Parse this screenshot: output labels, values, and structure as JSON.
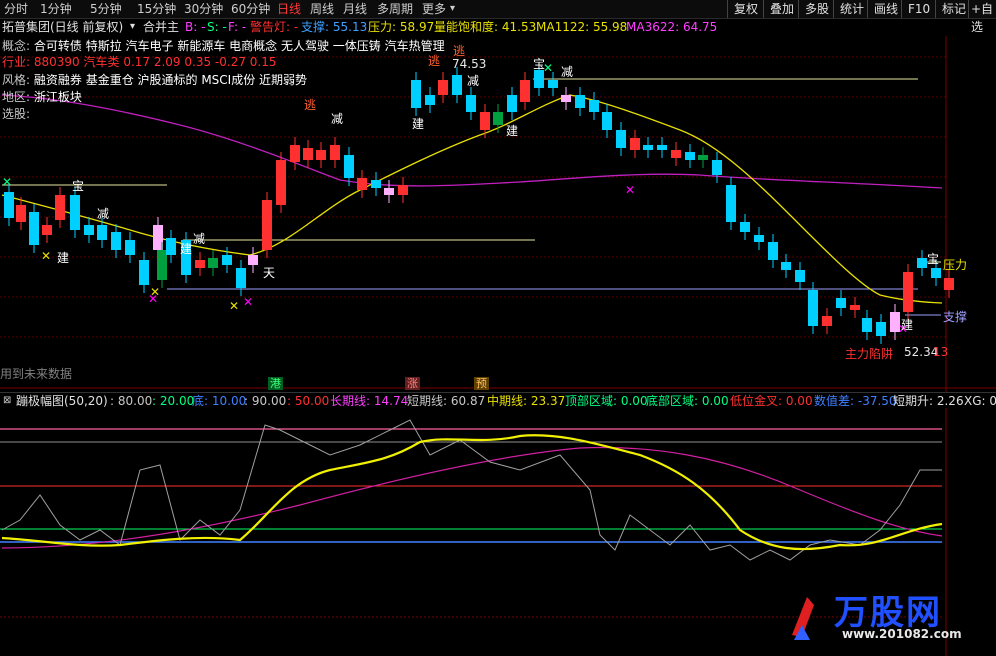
{
  "toolbar": {
    "tabs": [
      "分时",
      "1分钟",
      "5分钟",
      "15分钟",
      "30分钟",
      "60分钟",
      "日线",
      "周线",
      "月线",
      "多周期",
      "更多"
    ],
    "more_arrow": "▾",
    "right_buttons": [
      "复权",
      "叠加",
      "多股",
      "统计",
      "画线",
      "F10",
      "标记",
      "+自选"
    ],
    "active_tab": "日线"
  },
  "header": {
    "stock_name": "拓普集团(日线 前复权)",
    "dropdown_icon": "▾",
    "indicator_name": "合并主",
    "b_label": "B: -",
    "s_label": "S: -",
    "f_label": "F: -",
    "alarm": "警告灯: -",
    "support": "支撑: 55.13",
    "pressure": "压力: 58.97",
    "vol_sat": "量能饱和度: 41.53",
    "ma1122": "MA1122: 55.98",
    "ma3622": "MA3622: 64.75"
  },
  "info": {
    "concept_label": "概念:",
    "concept": "合可转债 特斯拉 汽车电子 新能源车 电商概念 无人驾驶 一体压铸 汽车热管理",
    "industry_label": "行业:",
    "industry": "880390 汽车类 0.17 2.09 0.35 -0.27 0.15",
    "style_label": "风格:",
    "style": "融资融券 基金重仓 沪股通标的 MSCI成份 近期弱势",
    "region_label": "地区:",
    "region": "浙江板块",
    "pick_label": "选股:"
  },
  "chart_labels": {
    "high_price": "74.53",
    "low_price": "52.34",
    "pressure": "压力",
    "support": "支撑",
    "main_trap": "主力陷阱",
    "future_data": "用到未来数据",
    "jian": "建",
    "jian2": "减",
    "tao": "逃",
    "bao": "宝",
    "tian": "天",
    "flag_gang": "港",
    "flag_zhang": "涨",
    "flag_yu": "预",
    "price_fragment": "13"
  },
  "indicator": {
    "title": "蹦极幅图(50,20)",
    "p1": ": 80.00",
    "p2": ": 20.00",
    "di": "底: 10.00",
    "p4": ": 90.00",
    "p5": ": 50.00",
    "long": "长期线: 14.74",
    "short": "短期线: 60.87",
    "mid": "中期线: 23.37",
    "top_zone": "顶部区域: 0.00",
    "bottom_zone": "底部区域: 0.00",
    "golden": "低位金叉: 0.00",
    "shudi": "数值差: -37.50",
    "short_rise": "短期升: 2.26",
    "xg": "XG: 0"
  },
  "watermark": {
    "brand": "万股网",
    "url": "www.201082.com"
  },
  "chart_data": {
    "type": "candlestick",
    "price_markers": {
      "high": 74.53,
      "low": 52.34,
      "support": 55.13,
      "pressure": 58.97
    }
  },
  "colors": {
    "up": "#ff3030",
    "down": "#00d0ff",
    "ma_yellow": "#e8e000",
    "ma_purple": "#d020d0",
    "active_tab": "#ff3a3a"
  }
}
